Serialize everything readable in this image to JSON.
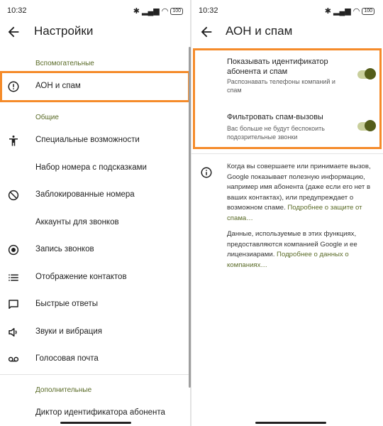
{
  "left": {
    "status": {
      "time": "10:32",
      "battery": "100"
    },
    "title": "Настройки",
    "sections": {
      "aux": "Вспомогательные",
      "general": "Общие",
      "extra": "Дополнительные"
    },
    "items": {
      "caller_id": "АОН и спам",
      "accessibility": "Специальные возможности",
      "assisted_dial": "Набор номера с подсказками",
      "blocked": "Заблокированные номера",
      "accounts": "Аккаунты для звонков",
      "recording": "Запись звонков",
      "contacts_display": "Отображение контактов",
      "quick_replies": "Быстрые ответы",
      "sounds": "Звуки и вибрация",
      "voicemail": "Голосовая почта",
      "announcer": "Диктор идентификатора абонента"
    }
  },
  "right": {
    "status": {
      "time": "10:32",
      "battery": "100"
    },
    "title": "АОН и спам",
    "switch1": {
      "title": "Показывать идентификатор абонента и спам",
      "subtitle": "Распознавать телефоны компаний и спам",
      "on": true
    },
    "switch2": {
      "title": "Фильтровать спам-вызовы",
      "subtitle": "Вас больше не будут беспокоить подозрительные звонки",
      "on": true
    },
    "info1": "Когда вы совершаете или принимаете вызов, Google показывает полезную информацию, например имя абонента (даже если его нет в ваших контактах), или предупреждает о возможном спаме.",
    "info1_link": "Подробнее о защите от спама…",
    "info2": "Данные, используемые в этих функциях, предоставляются компанией Google и ее лицензиарами.",
    "info2_link": "Подробнее о данных о компаниях…"
  },
  "colors": {
    "highlight": "#f58b2a",
    "accent": "#596a26",
    "toggle": "#545d1a"
  }
}
